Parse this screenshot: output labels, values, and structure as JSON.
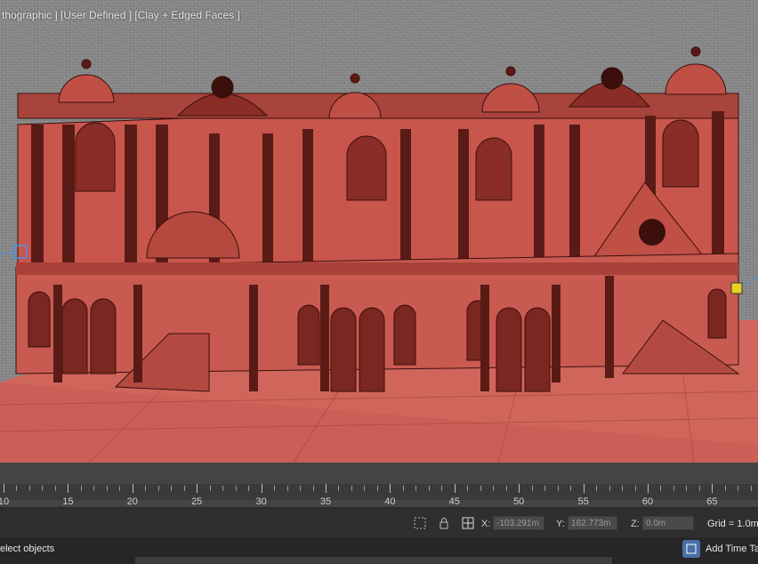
{
  "viewport": {
    "label": "thographic ] [User Defined ] [Clay + Edged Faces ]"
  },
  "timeline": {
    "ticks": [
      "10",
      "15",
      "20",
      "25",
      "30",
      "35",
      "40",
      "45",
      "50",
      "55",
      "60",
      "65"
    ]
  },
  "status": {
    "x_label": "X:",
    "x_value": "-103.291m",
    "y_label": "Y:",
    "y_value": "182.773m",
    "z_label": "Z:",
    "z_value": "0.0m",
    "grid": "Grid = 1.0m"
  },
  "bottom": {
    "prompt": "elect objects",
    "add_time_tag": "Add Time Ta"
  },
  "colors": {
    "clay": "#c8574f",
    "clay_dark": "#5a1b17",
    "ground": "#cf6a60"
  }
}
